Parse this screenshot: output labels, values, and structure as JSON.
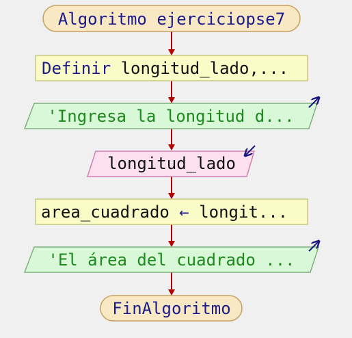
{
  "colors": {
    "background": "#f0f0f0",
    "terminal_fill": "#f8e8c4",
    "terminal_stroke": "#c8a060",
    "process_fill": "#fbfbc8",
    "process_stroke": "#c8c880",
    "output_fill": "#d8f8d8",
    "output_stroke": "#80b080",
    "input_fill": "#fce0f0",
    "input_stroke": "#d080b0",
    "arrow": "#b00000",
    "keyword_text": "#1c1c8c",
    "string_text": "#1e8a1e",
    "plain_text": "#111111"
  },
  "steps": {
    "start": {
      "keyword": "Algoritmo",
      "name": "ejerciciopse7"
    },
    "define": {
      "keyword": "Definir",
      "rest": "longitud_lado,..."
    },
    "write1": {
      "text": "'Ingresa la longitud d...",
      "icon": "output-arrow-icon"
    },
    "read": {
      "text": "longitud_lado",
      "icon": "input-arrow-icon"
    },
    "assign": {
      "target": "area_cuadrado",
      "operator": "←",
      "rest": "longit..."
    },
    "write2": {
      "text": "'El área del cuadrado ...",
      "icon": "output-arrow-icon"
    },
    "end": {
      "keyword": "FinAlgoritmo"
    }
  }
}
